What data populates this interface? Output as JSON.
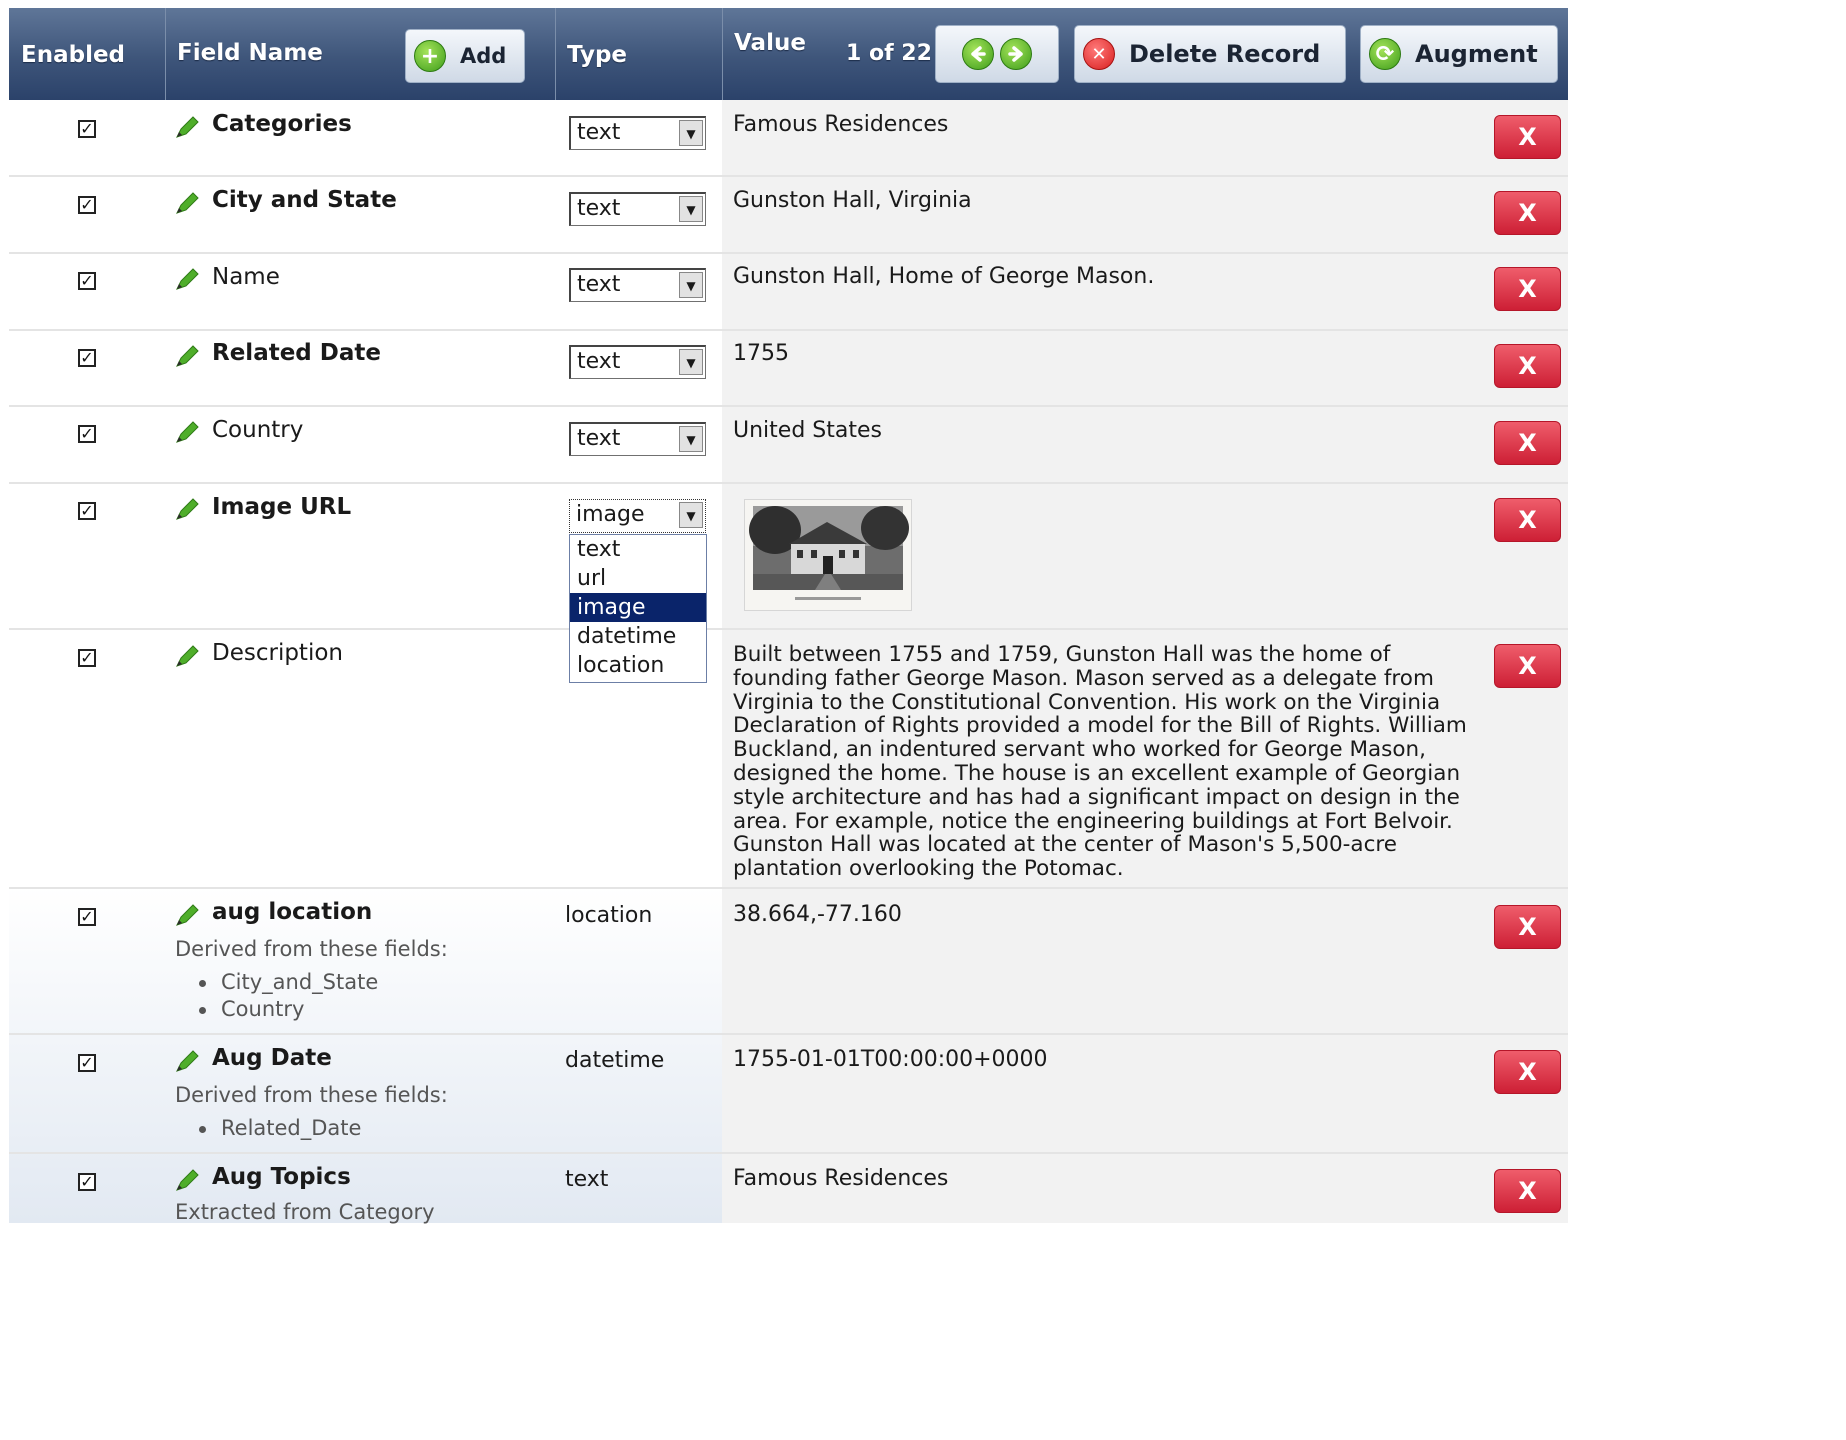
{
  "header": {
    "enabled": "Enabled",
    "field_name": "Field Name",
    "add": "Add",
    "type": "Type",
    "value": "Value",
    "record_counter": "1 of 22",
    "delete_record": "Delete Record",
    "augment": "Augment"
  },
  "rows": [
    {
      "name": "Categories",
      "type": "text",
      "value": "Famous Residences",
      "enabled": "✓"
    },
    {
      "name": "City and State",
      "type": "text",
      "value": "Gunston Hall, Virginia",
      "enabled": "✓"
    },
    {
      "name": "Name",
      "type": "text",
      "value": "Gunston Hall, Home of George Mason.",
      "enabled": "✓"
    },
    {
      "name": "Related Date",
      "type": "text",
      "value": "1755",
      "enabled": "✓"
    },
    {
      "name": "Country",
      "type": "text",
      "value": "United States",
      "enabled": "✓"
    },
    {
      "name": "Image URL",
      "type": "image",
      "enabled": "✓"
    },
    {
      "name": "Description",
      "enabled": "✓",
      "value": "Built between 1755 and 1759, Gunston Hall was the home of founding father George Mason. Mason served as a delegate from Virginia to the Constitutional Convention. His work on the Virginia Declaration of Rights provided a model for the Bill of Rights. William Buckland, an indentured servant who worked for George Mason, designed the home. The house is an excellent example of Georgian style architecture and has had a significant impact on design in the area. For example, notice the engineering buildings at Fort Belvoir. Gunston Hall was located at the center of Mason's 5,500-acre plantation overlooking the Potomac."
    },
    {
      "name": "aug location",
      "type": "location",
      "value": "38.664,-77.160",
      "enabled": "✓",
      "derived_label": "Derived from these fields:",
      "sources": [
        "City_and_State",
        "Country"
      ]
    },
    {
      "name": "Aug Date",
      "type": "datetime",
      "value": "1755-01-01T00:00:00+0000",
      "enabled": "✓",
      "derived_label": "Derived from these fields:",
      "sources": [
        "Related_Date"
      ]
    },
    {
      "name": "Aug Topics",
      "type": "text",
      "value": "Famous Residences",
      "enabled": "✓",
      "derived_label": "Extracted from Category"
    }
  ],
  "dropdown_options": [
    "text",
    "url",
    "image",
    "datetime",
    "location"
  ],
  "delete_label": "X",
  "colors": {
    "header": "#3e557a",
    "delete": "#d62a3f",
    "selected_option": "#0a246a"
  }
}
